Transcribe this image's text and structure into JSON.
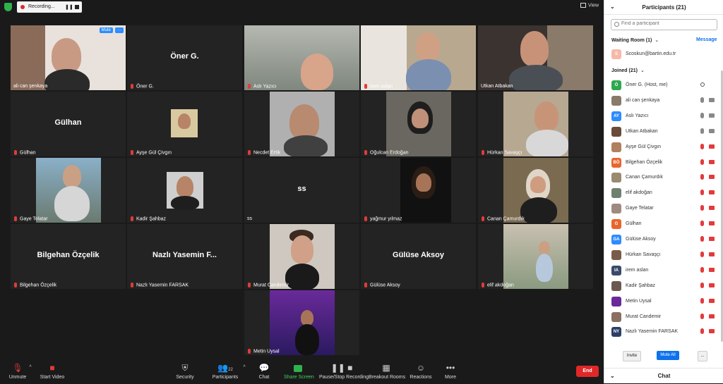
{
  "topbar": {
    "recording_label": "Recording...",
    "view_label": "View"
  },
  "tiles": [
    {
      "name": "ali can şenkaya",
      "label": "",
      "mute_label": "Mute",
      "more_label": "···"
    },
    {
      "name": "Öner G.",
      "label": "Öner G."
    },
    {
      "name": "Aslı Yazıcı",
      "label": ""
    },
    {
      "name": "irem aslan",
      "label": ""
    },
    {
      "name": "Utkan Atbakan",
      "label": ""
    },
    {
      "name": "Gülhan",
      "label": "Gülhan"
    },
    {
      "name": "Ayşe Gül Çivgın",
      "label": ""
    },
    {
      "name": "Necdet Ertik",
      "label": ""
    },
    {
      "name": "Oğulcan Erdoğan",
      "label": ""
    },
    {
      "name": "Hürkan Savaşçı",
      "label": ""
    },
    {
      "name": "Gaye Telatar",
      "label": ""
    },
    {
      "name": "Kadir Şahbaz",
      "label": ""
    },
    {
      "name": "ss",
      "label": "ss"
    },
    {
      "name": "yağmur yılmaz",
      "label": ""
    },
    {
      "name": "Canan Çamurdık",
      "label": ""
    },
    {
      "name": "Bilgehan Özçelik",
      "label": "Bilgehan Özçelik"
    },
    {
      "name": "Nazlı Yasemin FARSAK",
      "label": "Nazlı Yasemin F..."
    },
    {
      "name": "Murat Candemir",
      "label": ""
    },
    {
      "name": "Gülüse Aksoy",
      "label": "Gülüse Aksoy"
    },
    {
      "name": "elif akdoğan",
      "label": ""
    },
    {
      "name": "Metin Uysal",
      "label": ""
    }
  ],
  "toolbar": {
    "unmute": "Unmute",
    "start_video": "Start Video",
    "security": "Security",
    "participants": "Participants",
    "participants_count": "22",
    "chat": "Chat",
    "share_screen": "Share Screen",
    "recording": "Pause/Stop Recording",
    "breakout": "Breakout Rooms",
    "reactions": "Reactions",
    "more": "More",
    "end": "End"
  },
  "panel": {
    "title": "Participants (21)",
    "search_placeholder": "Find a participant",
    "waiting_room": "Waiting Room (1)",
    "message": "Message",
    "waiting_user": "Scoskun@bartin.edu.tr",
    "waiting_avatar": "S",
    "joined": "Joined (21)",
    "participants": [
      {
        "initials": "Ö",
        "name": "Öner G. (Host, me)",
        "color": "#2fa84f"
      },
      {
        "initials": "",
        "name": "ali can şenkaya",
        "color": "#8a7a6a"
      },
      {
        "initials": "AY",
        "name": "Aslı Yazıcı",
        "color": "#2d8cff"
      },
      {
        "initials": "",
        "name": "Utkan Atbakan",
        "color": "#6a4a3a"
      },
      {
        "initials": "",
        "name": "Ayşe Gül Çivgın",
        "color": "#b08060"
      },
      {
        "initials": "BÖ",
        "name": "Bilgehan Özçelik",
        "color": "#e8662e"
      },
      {
        "initials": "",
        "name": "Canan Çamurdık",
        "color": "#9a8a70"
      },
      {
        "initials": "",
        "name": "elif akdoğan",
        "color": "#708070"
      },
      {
        "initials": "",
        "name": "Gaye Telatar",
        "color": "#a08a80"
      },
      {
        "initials": "G",
        "name": "Gülhan",
        "color": "#e8662e"
      },
      {
        "initials": "GA",
        "name": "Gülüse Aksoy",
        "color": "#2d8cff"
      },
      {
        "initials": "",
        "name": "Hürkan Savaşçı",
        "color": "#7a5a4a"
      },
      {
        "initials": "IA",
        "name": "irem aslan",
        "color": "#3a4a6a"
      },
      {
        "initials": "",
        "name": "Kadir Şahbaz",
        "color": "#6a5a50"
      },
      {
        "initials": "",
        "name": "Metin Uysal",
        "color": "#6a2a9a"
      },
      {
        "initials": "",
        "name": "Murat Candemir",
        "color": "#8a7060"
      },
      {
        "initials": "NY",
        "name": "Nazlı Yasemin FARSAK",
        "color": "#2c3e66"
      }
    ],
    "invite": "Invite",
    "mute_all": "Mute All",
    "more": "...",
    "chat": "Chat"
  }
}
